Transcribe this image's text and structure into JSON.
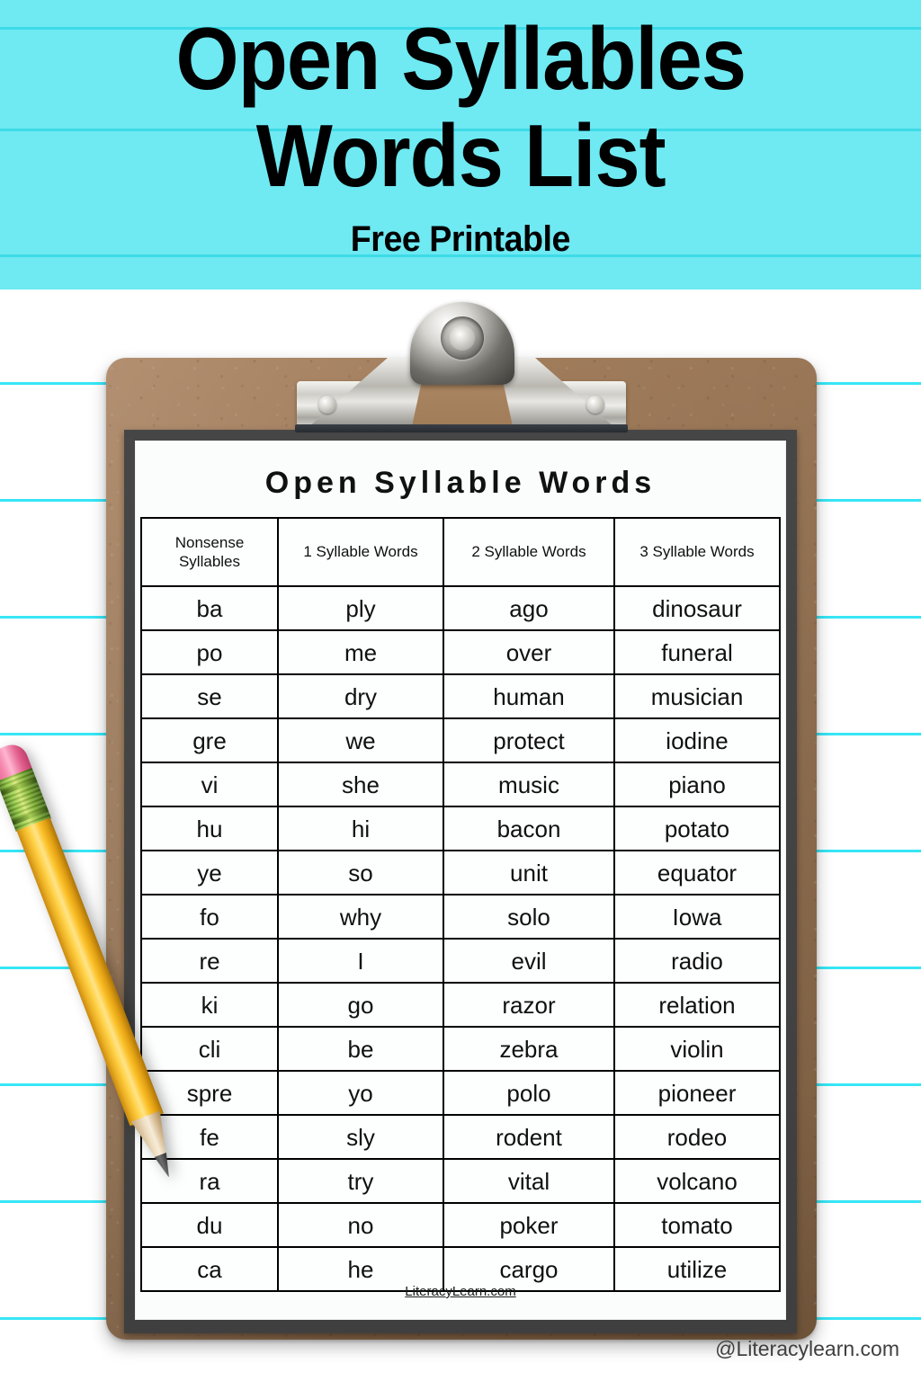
{
  "banner": {
    "title_line_1": "Open Syllables",
    "title_line_2": "Words List",
    "subtitle": "Free Printable",
    "background_color": "#6FE9F2",
    "rule_color": "#3DDBE8"
  },
  "background": {
    "color": "#FFFFFF",
    "rule_color": "#37E6F5"
  },
  "clipboard": {
    "board_color": "#9E7A59",
    "frame_color": "#434343",
    "paper_color": "#FBFDFD",
    "clip_color": "#CFCEC8"
  },
  "printable": {
    "title": "Open Syllable Words",
    "footer": "LiteracyLearn.com",
    "columns": [
      "Nonsense Syllables",
      "1 Syllable Words",
      "2 Syllable Words",
      "3 Syllable Words"
    ],
    "rows": [
      [
        "ba",
        "ply",
        "ago",
        "dinosaur"
      ],
      [
        "po",
        "me",
        "over",
        "funeral"
      ],
      [
        "se",
        "dry",
        "human",
        "musician"
      ],
      [
        "gre",
        "we",
        "protect",
        "iodine"
      ],
      [
        "vi",
        "she",
        "music",
        "piano"
      ],
      [
        "hu",
        "hi",
        "bacon",
        "potato"
      ],
      [
        "ye",
        "so",
        "unit",
        "equator"
      ],
      [
        "fo",
        "why",
        "solo",
        "Iowa"
      ],
      [
        "re",
        "I",
        "evil",
        "radio"
      ],
      [
        "ki",
        "go",
        "razor",
        "relation"
      ],
      [
        "cli",
        "be",
        "zebra",
        "violin"
      ],
      [
        "spre",
        "yo",
        "polo",
        "pioneer"
      ],
      [
        "fe",
        "sly",
        "rodent",
        "rodeo"
      ],
      [
        "ra",
        "try",
        "vital",
        "volcano"
      ],
      [
        "du",
        "no",
        "poker",
        "tomato"
      ],
      [
        "ca",
        "he",
        "cargo",
        "utilize"
      ]
    ]
  },
  "pencil": {
    "eraser_color": "#F588AE",
    "ferrule_color": "#8CC63F",
    "body_color": "#FFD34A",
    "tip_color": "#4A4A4A"
  },
  "watermark": "@Literacylearn.com"
}
